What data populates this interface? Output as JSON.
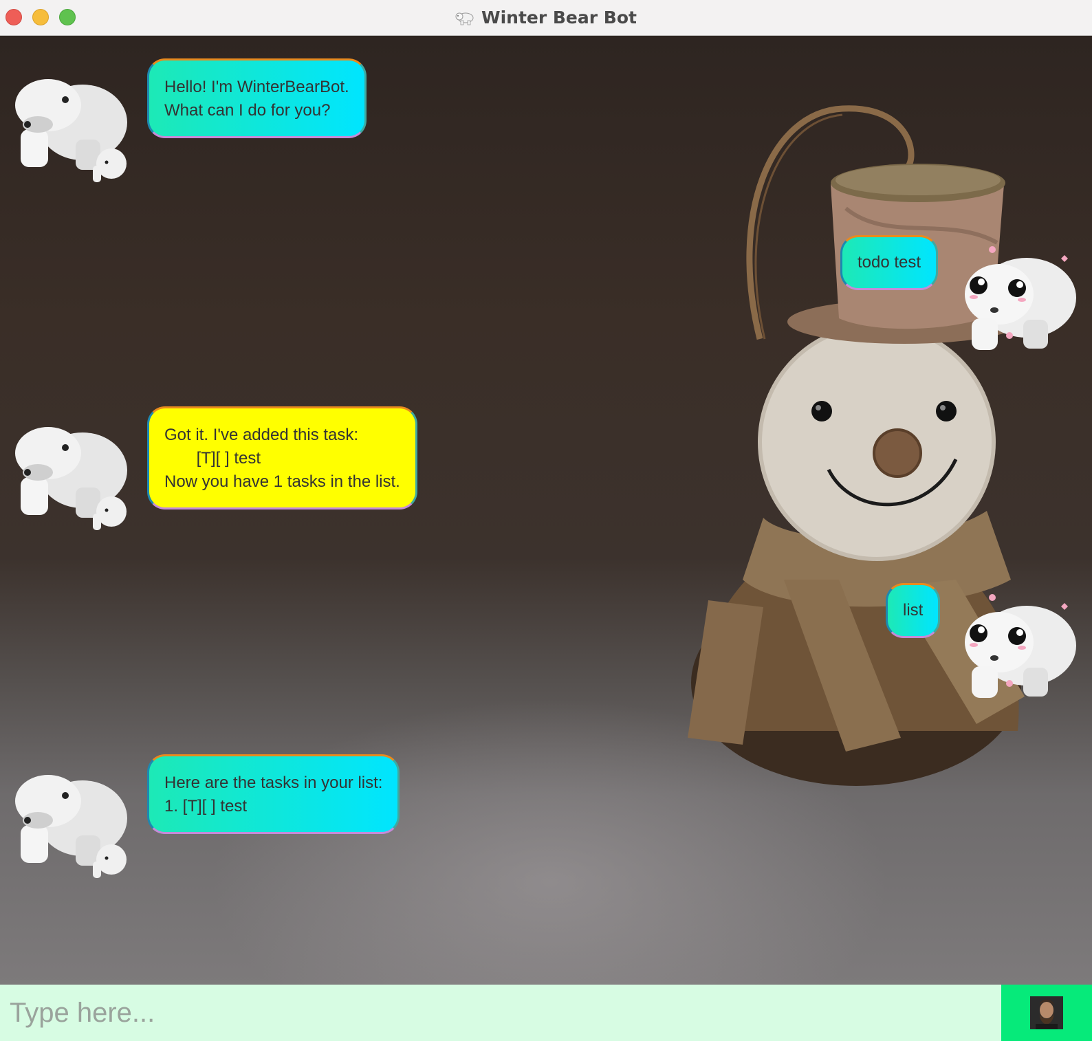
{
  "window": {
    "title": "Winter Bear Bot",
    "title_icon": "polar-bear-icon"
  },
  "messages": [
    {
      "sender": "bot",
      "text": "Hello! I'm WinterBearBot.\nWhat can I do for you?",
      "style": "cyan"
    },
    {
      "sender": "user",
      "text": "todo test",
      "style": "cyan"
    },
    {
      "sender": "bot",
      "text": "Got it. I've added this task:\n       [T][ ] test\nNow you have 1 tasks in the list.",
      "style": "yellow"
    },
    {
      "sender": "user",
      "text": "list",
      "style": "cyan"
    },
    {
      "sender": "bot",
      "text": "Here are the tasks in your list:\n1. [T][ ] test",
      "style": "cyan"
    }
  ],
  "input": {
    "placeholder": "Type here...",
    "value": ""
  },
  "send_button": {
    "icon": "user-avatar-icon"
  },
  "colors": {
    "bubble_cyan_start": "#1de9b6",
    "bubble_cyan_end": "#00e5ff",
    "bubble_yellow": "#ffff00",
    "input_bg": "#d7fce3",
    "send_bg": "#06ea7a"
  }
}
